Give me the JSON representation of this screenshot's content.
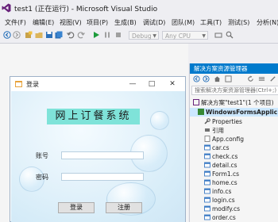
{
  "window": {
    "title": "test1 (正在运行) - Microsoft Visual Studio"
  },
  "menu": [
    "文件(F)",
    "编辑(E)",
    "视图(V)",
    "项目(P)",
    "生成(B)",
    "调试(D)",
    "团队(M)",
    "工具(T)",
    "测试(S)",
    "分析(N)"
  ],
  "toolbar": {
    "config": "Debug",
    "platform": "Any CPU"
  },
  "solution_explorer": {
    "title": "解决方案资源管理器",
    "search_placeholder": "搜索解决方案资源管理器(Ctrl+;)",
    "items": [
      {
        "label": "解决方案\"test1\"(1 个项目)"
      },
      {
        "label": "WindowsFormsApplic"
      },
      {
        "label": "Properties"
      },
      {
        "label": "引用"
      },
      {
        "label": "App.config"
      },
      {
        "label": "car.cs"
      },
      {
        "label": "check.cs"
      },
      {
        "label": "detail.cs"
      },
      {
        "label": "Form1.cs"
      },
      {
        "label": "home.cs"
      },
      {
        "label": "info.cs"
      },
      {
        "label": "login.cs"
      },
      {
        "label": "modify.cs"
      },
      {
        "label": "order.cs"
      }
    ]
  },
  "login_form": {
    "title": "登录",
    "banner": "网上订餐系统",
    "account_label": "账号",
    "password_label": "密码",
    "account_value": "",
    "password_value": "",
    "login_button": "登录",
    "register_button": "注册",
    "minimize": "—",
    "maximize": "□",
    "close": "✕"
  }
}
